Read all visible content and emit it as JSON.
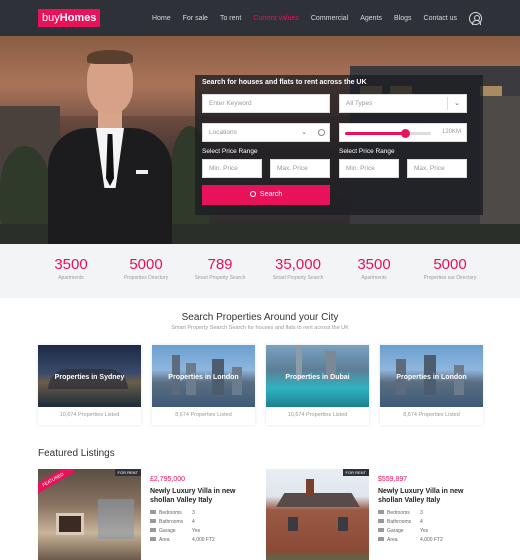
{
  "header": {
    "logo": {
      "part1": "buy",
      "part2": "Homes"
    },
    "nav": [
      "Home",
      "For sale",
      "To rent",
      "Current values",
      "Commercial",
      "Agents",
      "Blogs",
      "Contact us"
    ],
    "active_nav": "Current values"
  },
  "search": {
    "title": "Search for houses and flats to rent across the UK",
    "keyword_placeholder": "Enter Keyword",
    "type_select": "All Types",
    "location_placeholder": "Locations",
    "range_label": "120KM",
    "range_value": 0.7,
    "price_range_label_1": "Select Price Range",
    "price_range_label_2": "Select Price Range",
    "min_price_1": "Min. Price",
    "max_price_1": "Max. Price",
    "min_price_2": "Min. Price",
    "max_price_2": "Max. Price",
    "button": "Search"
  },
  "stats": [
    {
      "num": "3500",
      "label": "Apartments"
    },
    {
      "num": "5000",
      "label": "Properties Directory"
    },
    {
      "num": "789",
      "label": "Smart Property Search"
    },
    {
      "num": "35,000",
      "label": "Smart Property Search"
    },
    {
      "num": "3500",
      "label": "Apartments"
    },
    {
      "num": "5000",
      "label": "Properties our Directory"
    }
  ],
  "around": {
    "title": "Search Properties Around your City",
    "subtitle": "Smart Property Search Search for houses and flats to rent across the UK",
    "cities": [
      {
        "name": "Properties in Sydney",
        "count": "10,674 Properties Listed"
      },
      {
        "name": "Properties in London",
        "count": "8,674 Properties Listed"
      },
      {
        "name": "Properties in Dubai",
        "count": "10,674 Properties Listed"
      },
      {
        "name": "Properties in London",
        "count": "8,674 Properties Listed"
      }
    ]
  },
  "featured": {
    "title": "Featured Listings",
    "listings": [
      {
        "badge": "FEATURED",
        "tag": "FOR RENT",
        "price": "£2,795,000",
        "title": "Newly Luxury Villa in new shollan Valley Italy",
        "specs": [
          {
            "k": "Bedrooms",
            "v": "3"
          },
          {
            "k": "Bathrooms",
            "v": "4"
          },
          {
            "k": "Garage",
            "v": "Yes"
          },
          {
            "k": "Area",
            "v": "4,000 FT2"
          }
        ]
      },
      {
        "tag": "FOR RENT",
        "price": "$559,897",
        "title": "Newly Luxury Villa in new shollan Valley Italy",
        "specs": [
          {
            "k": "Bedrooms",
            "v": "3"
          },
          {
            "k": "Bathrooms",
            "v": "4"
          },
          {
            "k": "Garage",
            "v": "Yes"
          },
          {
            "k": "Area",
            "v": "4,000 FT2"
          }
        ]
      }
    ]
  },
  "colors": {
    "accent": "#e8125a",
    "header_bg": "#2e3138",
    "stats_bg": "#f3f4f6"
  }
}
